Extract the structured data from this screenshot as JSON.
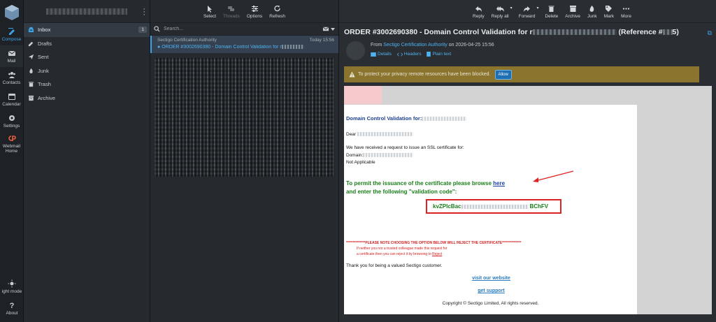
{
  "rail": {
    "items": [
      {
        "label": "Compose"
      },
      {
        "label": "Mail"
      },
      {
        "label": "Contacts"
      },
      {
        "label": "Calendar"
      },
      {
        "label": "Settings"
      },
      {
        "label": "Webmail"
      },
      {
        "label": "Home"
      }
    ],
    "bottom": [
      {
        "label": "ight mode"
      },
      {
        "label": "About"
      }
    ]
  },
  "folders": {
    "items": [
      {
        "label": "Inbox",
        "count": "1"
      },
      {
        "label": "Drafts"
      },
      {
        "label": "Sent"
      },
      {
        "label": "Junk"
      },
      {
        "label": "Trash"
      },
      {
        "label": "Archive"
      }
    ]
  },
  "list_toolbar": {
    "select": "Select",
    "threads": "Threads",
    "options": "Options",
    "refresh": "Refresh"
  },
  "search": {
    "placeholder": "Search..."
  },
  "message": {
    "sender": "Sectigo Certification Authority",
    "time": "Today 15:56",
    "subject": "ORDER #3002690380 - Domain Control Validation for r"
  },
  "reader_toolbar": {
    "reply": "Reply",
    "reply_all": "Reply all",
    "forward": "Forward",
    "delete": "Delete",
    "archive": "Archive",
    "junk": "Junk",
    "mark": "Mark",
    "more": "More"
  },
  "header": {
    "subject_start": "ORDER #3002690380 - Domain Control Validation for r",
    "subject_end": "(Reference #",
    "subject_tail": "5)",
    "from_label": "From",
    "from_name": "Sectigo Certification Authority",
    "from_date": "on 2026-04-25 15:56",
    "details": "Details",
    "headers": "Headers",
    "plain_text": "Plain text"
  },
  "privacy": {
    "text": "To protect your privacy remote resources have been blocked.",
    "allow": "Allow"
  },
  "mail": {
    "heading": "Domain Control Validation for:",
    "dear": "Dear",
    "received": "We have received a request to issue an SSL certificate for:",
    "domain": "Domain:",
    "not_applicable": "Not Applicable",
    "permit_line1": "To permit the issuance of the certificate please browse ",
    "here": "here",
    "permit_line2": "and enter the following \"validation code\":",
    "code_start": "kvZPIcBac",
    "code_end": "BChFV",
    "warn1": "**************PLEASE NOTE CHOOSING THE OPTION BELOW WILL REJECT THE CERTIFICATE**************",
    "warn2": "If neither you nor a trusted colleague made this request for",
    "warn3": "a certificate then you can reject it by browsing to ",
    "reject": "Reject",
    "thanks": "Thank you for being a valued Sectigo customer.",
    "visit": "visit our website",
    "support": "get support",
    "copyright": "Copyright © Sectigo Limited, All rights reserved."
  },
  "colors": {
    "accent": "#3ea4e6",
    "webmail": "#e8603a",
    "privacy_bar": "#8a742e",
    "code_green": "#1a7e1a",
    "alert_red": "#d22222"
  }
}
